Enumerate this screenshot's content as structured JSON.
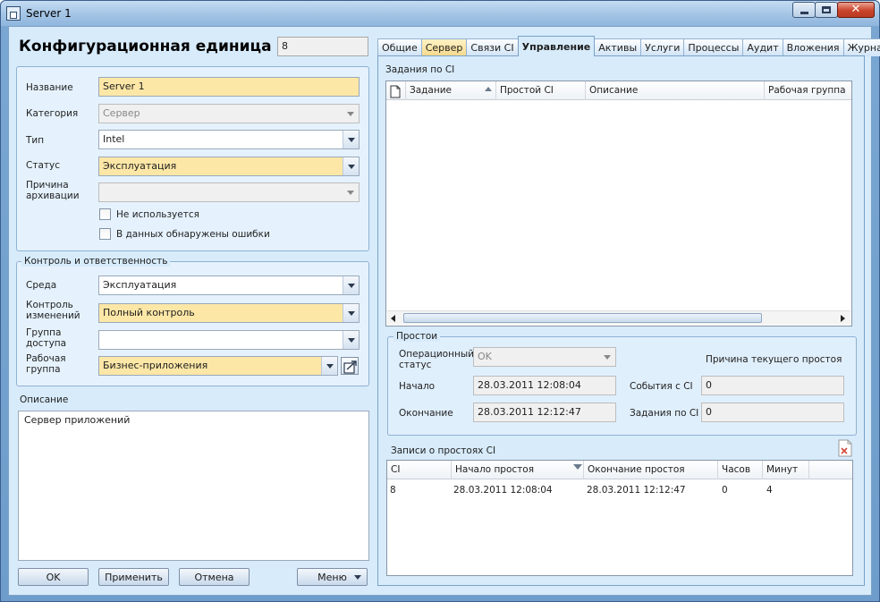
{
  "window": {
    "title": "Server 1"
  },
  "form": {
    "title": "Конфигурационная единица",
    "id_value": "8"
  },
  "main_fields": {
    "name_label": "Название",
    "name_value": "Server 1",
    "category_label": "Категория",
    "category_value": "Сервер",
    "type_label": "Тип",
    "type_value": "Intel",
    "status_label": "Статус",
    "status_value": "Эксплуатация",
    "archive_label": "Причина архивации",
    "archive_value": "",
    "not_used_label": "Не используется",
    "errors_label": "В данных обнаружены ошибки"
  },
  "control": {
    "legend": "Контроль и ответственность",
    "env_label": "Среда",
    "env_value": "Эксплуатация",
    "change_label": "Контроль изменений",
    "change_value": "Полный контроль",
    "access_label": "Группа доступа",
    "access_value": "",
    "workgroup_label": "Рабочая группа",
    "workgroup_value": "Бизнес-приложения"
  },
  "description": {
    "label": "Описание",
    "value": "Сервер приложений"
  },
  "buttons": {
    "ok": "OK",
    "apply": "Применить",
    "cancel": "Отмена",
    "menu": "Меню"
  },
  "tabs": [
    "Общие",
    "Сервер",
    "Связи CI",
    "Управление",
    "Активы",
    "Услуги",
    "Процессы",
    "Аудит",
    "Вложения",
    "Журнал"
  ],
  "tasks": {
    "label": "Задания по CI",
    "columns": [
      "Задание",
      "Простой CI",
      "Описание",
      "Рабочая группа"
    ]
  },
  "downtime": {
    "legend": "Простои",
    "op_status_label": "Операционный статус",
    "op_status_value": "OK",
    "reason_label": "Причина текущего простоя",
    "start_label": "Начало",
    "start_value": "28.03.2011 12:08:04",
    "end_label": "Окончание",
    "end_value": "28.03.2011 12:12:47",
    "events_label": "События с CI",
    "events_value": "0",
    "tasks_label": "Задания по CI",
    "tasks_value": "0"
  },
  "records": {
    "label": "Записи о простоях CI",
    "columns": [
      "CI",
      "Начало простоя",
      "Окончание простоя",
      "Часов",
      "Минут"
    ],
    "rows": [
      {
        "ci": "8",
        "start": "28.03.2011 12:08:04",
        "end": "28.03.2011 12:12:47",
        "hours": "0",
        "minutes": "4"
      }
    ]
  }
}
